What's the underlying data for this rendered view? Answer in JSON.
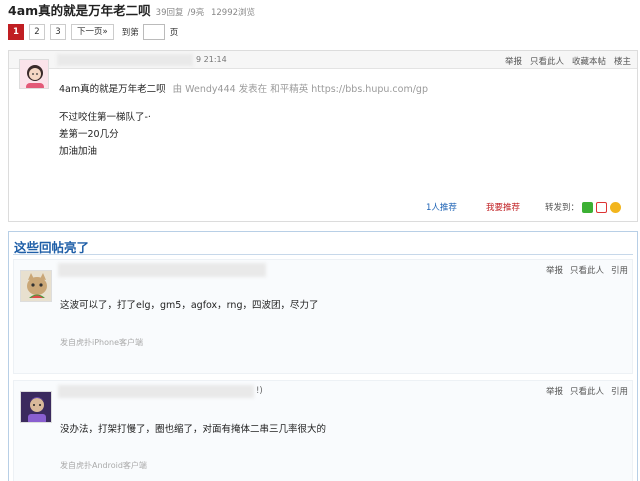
{
  "thread": {
    "title": "4am真的就是万年老二呗",
    "replies": "39回复",
    "lights": "/9亮",
    "views": "12992浏览"
  },
  "pager": {
    "pages": [
      "1",
      "2",
      "3"
    ],
    "current": "1",
    "next": "下一页»",
    "jump_label": "到第",
    "page_suffix": "页"
  },
  "main_post": {
    "time": "9 21:14",
    "actions": [
      "举报",
      "只看此人",
      "收藏本帖",
      "楼主"
    ],
    "title_line": "4am真的就是万年老二呗",
    "meta_line": "由 Wendy444 发表在 和平精英 https://bbs.hupu.com/gp",
    "body": [
      "不过咬住第一梯队了-·",
      "差第一20几分",
      "加油加油"
    ],
    "recommend_count": "1人",
    "recommend_label": "推荐",
    "my_recommend": "我要推荐",
    "share_label": "转发到："
  },
  "highlights": {
    "title": "这些回帖亮了",
    "replies": [
      {
        "actions": [
          "举报",
          "只看此人",
          "引用"
        ],
        "text": "这波可以了，打了elg，gm5，agfox，rng，四波团，尽力了",
        "source": "发自虎扑iPhone客户端"
      },
      {
        "name_tail": "!)",
        "actions": [
          "举报",
          "只看此人",
          "引用"
        ],
        "text": "没办法，打架打慢了，圈也缩了，对面有掩体二串三几率很大的",
        "source": "发自虎扑Android客户端"
      }
    ]
  },
  "colors": {
    "accent_red": "#c01e22",
    "link_blue": "#1e63b5",
    "highlight_blue": "#1f5fa8"
  }
}
